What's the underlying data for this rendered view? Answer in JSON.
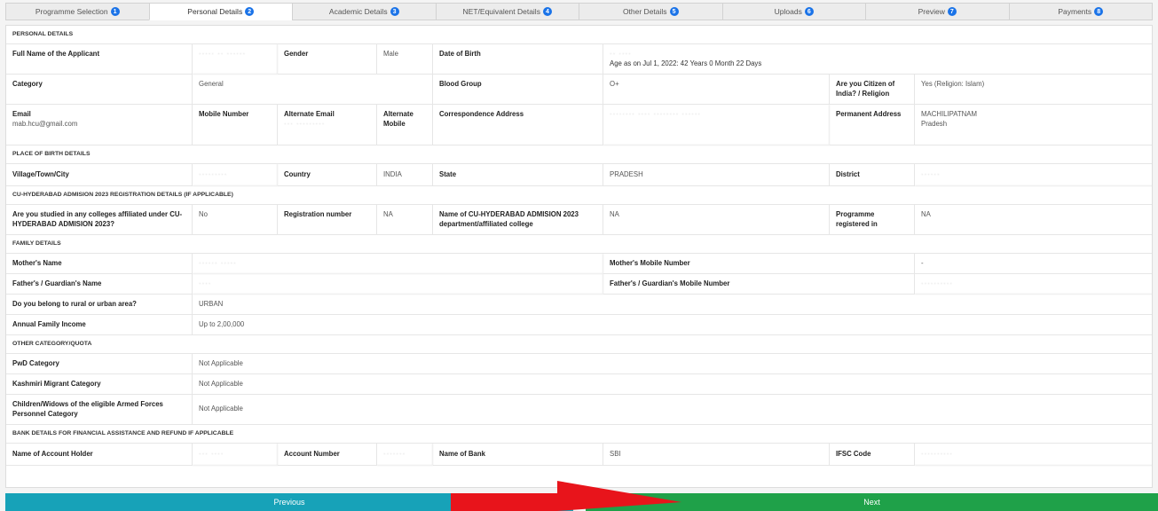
{
  "tabs": [
    {
      "label": "Programme Selection",
      "num": "1"
    },
    {
      "label": "Personal Details",
      "num": "2"
    },
    {
      "label": "Academic Details",
      "num": "3"
    },
    {
      "label": "NET/Equivalent Details",
      "num": "4"
    },
    {
      "label": "Other Details",
      "num": "5"
    },
    {
      "label": "Uploads",
      "num": "6"
    },
    {
      "label": "Preview",
      "num": "7"
    },
    {
      "label": "Payments",
      "num": "8"
    }
  ],
  "sections": {
    "personal": "PERSONAL DETAILS",
    "birth": "PLACE OF BIRTH DETAILS",
    "cuh": "CU-HYDERABAD ADMISION 2023 REGISTRATION DETAILS (IF APPLICABLE)",
    "family": "FAMILY DETAILS",
    "quota": "OTHER CATEGORY/QUOTA",
    "bank": "BANK DETAILS FOR FINANCIAL ASSISTANCE AND REFUND IF APPLICABLE"
  },
  "personal": {
    "full_name_label": "Full Name of the Applicant",
    "full_name_value": "····· ·· ······",
    "gender_label": "Gender",
    "gender_value": "Male",
    "dob_label": "Date of Birth",
    "dob_value": "·· ····",
    "age_text": "Age as on Jul 1, 2022: 42 Years 0 Month 22 Days",
    "category_label": "Category",
    "category_value": "General",
    "blood_label": "Blood Group",
    "blood_value": "O+",
    "citizen_label": "Are you Citizen of India? / Religion",
    "citizen_value": "Yes (Religion: Islam)",
    "email_label": "Email",
    "email_value": "mab.hcu@gmail.com",
    "mobile_label": "Mobile Number",
    "alt_email_label": "Alternate Email",
    "alt_mobile_label": "Alternate Mobile",
    "corr_addr_label": "Correspondence Address",
    "perm_addr_label": "Permanent Address",
    "perm_addr_value": "MACHILIPATNAM",
    "perm_addr_value2": "Pradesh"
  },
  "birth": {
    "village_label": "Village/Town/City",
    "country_label": "Country",
    "country_value": "INDIA",
    "state_label": "State",
    "state_value": "PRADESH",
    "district_label": "District"
  },
  "cuh": {
    "studied_label": "Are you studied in any colleges affiliated under CU-HYDERABAD ADMISION 2023?",
    "studied_value": "No",
    "reg_label": "Registration number",
    "reg_value": "NA",
    "dept_label": "Name of CU-HYDERABAD ADMISION 2023 department/affiliated college",
    "dept_value": "NA",
    "prog_label": "Programme registered in",
    "prog_value": "NA"
  },
  "family": {
    "mother_label": "Mother's Name",
    "mother_mobile_label": "Mother's Mobile Number",
    "mother_mobile_value": "-",
    "father_label": "Father's / Guardian's Name",
    "father_mobile_label": "Father's / Guardian's Mobile Number",
    "area_label": "Do you belong to rural or urban area?",
    "area_value": "URBAN",
    "income_label": "Annual Family Income",
    "income_value": "Up to 2,00,000"
  },
  "quota": {
    "pwd_label": "PwD Category",
    "pwd_value": "Not Applicable",
    "kashmiri_label": "Kashmiri Migrant Category",
    "kashmiri_value": "Not Applicable",
    "armed_label": "Children/Widows of the eligible Armed Forces Personnel Category",
    "armed_value": "Not Applicable"
  },
  "bank": {
    "holder_label": "Name of Account Holder",
    "acc_label": "Account Number",
    "bank_label": "Name of Bank",
    "bank_value": "SBI",
    "ifsc_label": "IFSC Code"
  },
  "nav": {
    "previous": "Previous",
    "next": "Next"
  },
  "colors": {
    "prev": "#17a2b8",
    "next": "#1fa149",
    "arrow": "#e8141b",
    "badge": "#1a73e8"
  }
}
